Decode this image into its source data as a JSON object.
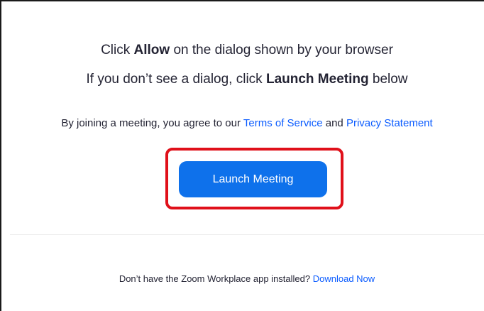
{
  "instructions": {
    "line1_prefix": "Click ",
    "line1_bold": "Allow",
    "line1_suffix": " on the dialog shown by your browser",
    "line2_prefix": "If you don’t see a dialog, click ",
    "line2_bold": "Launch Meeting",
    "line2_suffix": " below"
  },
  "terms": {
    "prefix": "By joining a meeting, you agree to our ",
    "terms_link": "Terms of Service",
    "conjunction": " and ",
    "privacy_link": "Privacy Statement"
  },
  "launch_button": {
    "label": "Launch Meeting",
    "color": "#0e71eb",
    "highlight_color": "#e0101a"
  },
  "footer": {
    "prefix": "Don’t have the Zoom Workplace app installed? ",
    "download_link": "Download Now"
  },
  "colors": {
    "link": "#0b5cff",
    "text": "#232333"
  }
}
